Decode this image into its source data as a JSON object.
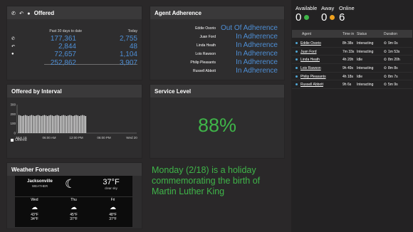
{
  "offered": {
    "title": "Offered",
    "col1_label": "Past 30 days to date",
    "col2_label": "Today",
    "rows": [
      {
        "icon": "phone-icon",
        "glyph": "✆",
        "v1": "177,361",
        "v2": "2,755"
      },
      {
        "icon": "callback-icon",
        "glyph": "↶",
        "v1": "2,844",
        "v2": "48"
      },
      {
        "icon": "chat-icon",
        "glyph": "●",
        "v1": "72,657",
        "v2": "1,104"
      }
    ],
    "total1": "252,862",
    "total2": "3,907"
  },
  "adherence": {
    "title": "Agent Adherence",
    "rows": [
      {
        "name": "Eddie Osorio",
        "status": "Out Of Adherence"
      },
      {
        "name": "Juan Ford",
        "status": "In Adherence"
      },
      {
        "name": "Linda Heath",
        "status": "In Adherence"
      },
      {
        "name": "Lois Rawson",
        "status": "In Adherence"
      },
      {
        "name": "Philip Pleasants",
        "status": "In Adherence"
      },
      {
        "name": "Russell Abbott",
        "status": "In Adherence"
      }
    ]
  },
  "interval": {
    "title": "Offered by Interval",
    "legend": "Offered",
    "y_ticks": [
      "300",
      "200",
      "100",
      "0"
    ],
    "x_ticks": [
      "Mon 18",
      "06:00 AM",
      "12:00 PM",
      "06:00 PM",
      "Wed 20"
    ]
  },
  "chart_data": {
    "type": "bar",
    "title": "Offered by Interval",
    "xlabel": "",
    "ylabel": "",
    "ylim": [
      0,
      300
    ],
    "series": [
      {
        "name": "Offered",
        "values": [
          190,
          185,
          180,
          185,
          190,
          185,
          180,
          185,
          190,
          185,
          180,
          185,
          190,
          185,
          180,
          185,
          190,
          185,
          180,
          185,
          190,
          185,
          180,
          185,
          190,
          185,
          180,
          185,
          190,
          185,
          180,
          185,
          190,
          185,
          180,
          185,
          190,
          185,
          180,
          185,
          190,
          185,
          180
        ]
      }
    ],
    "x_tick_labels": [
      "Mon 18",
      "06:00 AM",
      "12:00 PM",
      "06:00 PM",
      "Wed 20"
    ],
    "legend_position": "bottom-left",
    "grid": false
  },
  "service_level": {
    "title": "Service Level",
    "value": "88%",
    "color": "#3fb549"
  },
  "weather": {
    "title": "Weather Forecast",
    "location": "Jacksonville",
    "subtitle": "WEATHER",
    "current_temp": "37°F",
    "current_desc": "clear sky",
    "days": [
      {
        "name": "Wed",
        "high": "43°F",
        "low": "34°F"
      },
      {
        "name": "Thu",
        "high": "45°F",
        "low": "37°F"
      },
      {
        "name": "Fri",
        "high": "48°F",
        "low": "37°F"
      }
    ]
  },
  "holiday": {
    "text": "Monday (2/18) is a holiday commemorating the birth of Martin Luther King"
  },
  "stats": {
    "available_label": "Available",
    "available_value": "0",
    "away_label": "Away",
    "away_value": "0",
    "online_label": "Online",
    "online_value": "6",
    "available_color": "#3fb549",
    "away_color": "#f0a21e"
  },
  "agents": {
    "headers": {
      "agent": "Agent",
      "time_in": "Time in",
      "status": "Status",
      "duration": "Duration"
    },
    "rows": [
      {
        "name": "Eddie Osorio",
        "time_in": "8h 38s",
        "status": "Interacting",
        "duration": "9m 0s"
      },
      {
        "name": "Juan Ford",
        "time_in": "7m 33s",
        "status": "Interacting",
        "duration": "1m 53s"
      },
      {
        "name": "Linda Heath",
        "time_in": "4h 20h",
        "status": "Idle",
        "duration": "8m 20h"
      },
      {
        "name": "Lois Rawson",
        "time_in": "9h 49s",
        "status": "Interacting",
        "duration": "8m 8s"
      },
      {
        "name": "Philip Pleasants",
        "time_in": "4h 18s",
        "status": "Idle",
        "duration": "8m 7s"
      },
      {
        "name": "Russell Abbott",
        "time_in": "9h 6s",
        "status": "Interacting",
        "duration": "5m 9s"
      }
    ]
  }
}
